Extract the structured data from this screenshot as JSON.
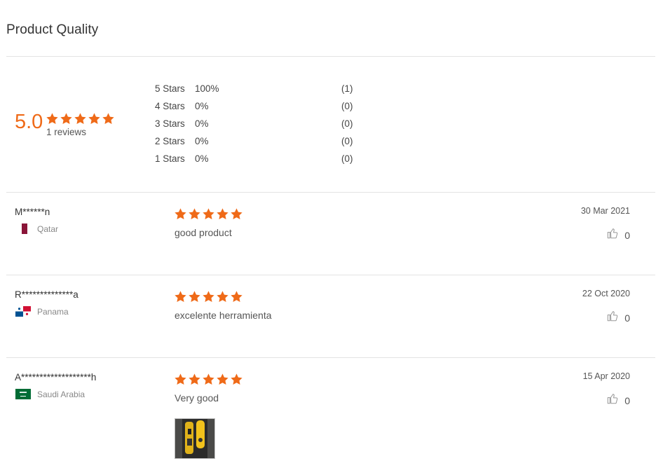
{
  "section": {
    "title": "Product Quality"
  },
  "summary": {
    "average": "5.0",
    "rating": 5,
    "reviews_label": "1 reviews",
    "distribution": [
      {
        "label": "5 Stars",
        "percent": "100%",
        "count": "(1)"
      },
      {
        "label": "4 Stars",
        "percent": "0%",
        "count": "(0)"
      },
      {
        "label": "3 Stars",
        "percent": "0%",
        "count": "(0)"
      },
      {
        "label": "2 Stars",
        "percent": "0%",
        "count": "(0)"
      },
      {
        "label": "1 Stars",
        "percent": "0%",
        "count": "(0)"
      }
    ]
  },
  "reviews": [
    {
      "name": "M******n",
      "country": "Qatar",
      "flag_icon": "qatar-flag-icon",
      "rating": 5,
      "text": "good product",
      "date": "30 Mar 2021",
      "likes": "0"
    },
    {
      "name": "R**************a",
      "country": "Panama",
      "flag_icon": "panama-flag-icon",
      "rating": 5,
      "text": "excelente herramienta",
      "date": "22 Oct 2020",
      "likes": "0"
    },
    {
      "name": "A*******************h",
      "country": "Saudi Arabia",
      "flag_icon": "saudi-arabia-flag-icon",
      "rating": 5,
      "text": "Very good",
      "date": "15 Apr 2020",
      "likes": "0",
      "photo": "review-photo-thumbnail"
    }
  ],
  "colors": {
    "accent": "#ef6a18",
    "divider": "#e3e3e3",
    "muted": "#888888"
  },
  "icons": {
    "star": "star-icon",
    "like": "thumbs-up-icon"
  }
}
